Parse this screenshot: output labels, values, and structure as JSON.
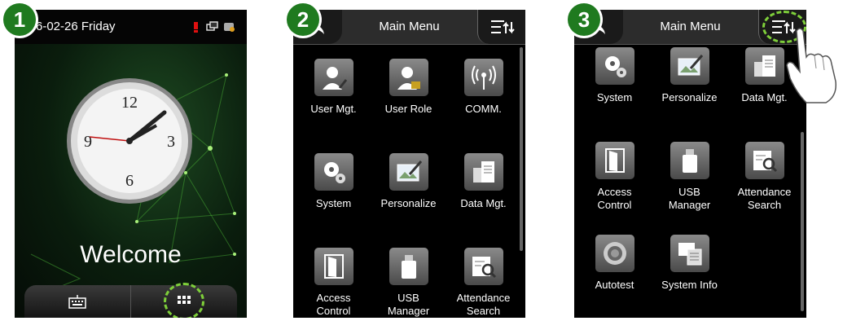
{
  "steps": [
    "1",
    "2",
    "3"
  ],
  "screen1": {
    "date_text": "6-02-26  Friday",
    "welcome": "Welcome",
    "bottom_buttons": [
      {
        "icon": "keyboard-icon"
      },
      {
        "icon": "menu-grid-icon"
      }
    ],
    "clock": {
      "numerals": [
        "12",
        "3",
        "6",
        "9"
      ]
    }
  },
  "screen2": {
    "title": "Main Menu",
    "items": [
      {
        "label": "User Mgt.",
        "icon": "user-mgt-icon"
      },
      {
        "label": "User Role",
        "icon": "user-role-icon"
      },
      {
        "label": "COMM.",
        "icon": "comm-icon"
      },
      {
        "label": "System",
        "icon": "system-icon"
      },
      {
        "label": "Personalize",
        "icon": "personalize-icon"
      },
      {
        "label": "Data Mgt.",
        "icon": "data-mgt-icon"
      },
      {
        "label": "Access\nControl",
        "icon": "access-control-icon"
      },
      {
        "label": "USB\nManager",
        "icon": "usb-manager-icon"
      },
      {
        "label": "Attendance\nSearch",
        "icon": "attendance-search-icon"
      }
    ]
  },
  "screen3": {
    "title": "Main Menu",
    "items": [
      {
        "label": "System",
        "icon": "system-icon"
      },
      {
        "label": "Personalize",
        "icon": "personalize-icon"
      },
      {
        "label": "Data Mgt.",
        "icon": "data-mgt-icon"
      },
      {
        "label": "Access\nControl",
        "icon": "access-control-icon"
      },
      {
        "label": "USB\nManager",
        "icon": "usb-manager-icon"
      },
      {
        "label": "Attendance\nSearch",
        "icon": "attendance-search-icon"
      },
      {
        "label": "Autotest",
        "icon": "autotest-icon"
      },
      {
        "label": "System Info",
        "icon": "system-info-icon"
      }
    ]
  },
  "colors": {
    "accent_green": "#1f7a1f",
    "highlight_dash": "#7ecf3a",
    "alert_red": "#e01010"
  }
}
